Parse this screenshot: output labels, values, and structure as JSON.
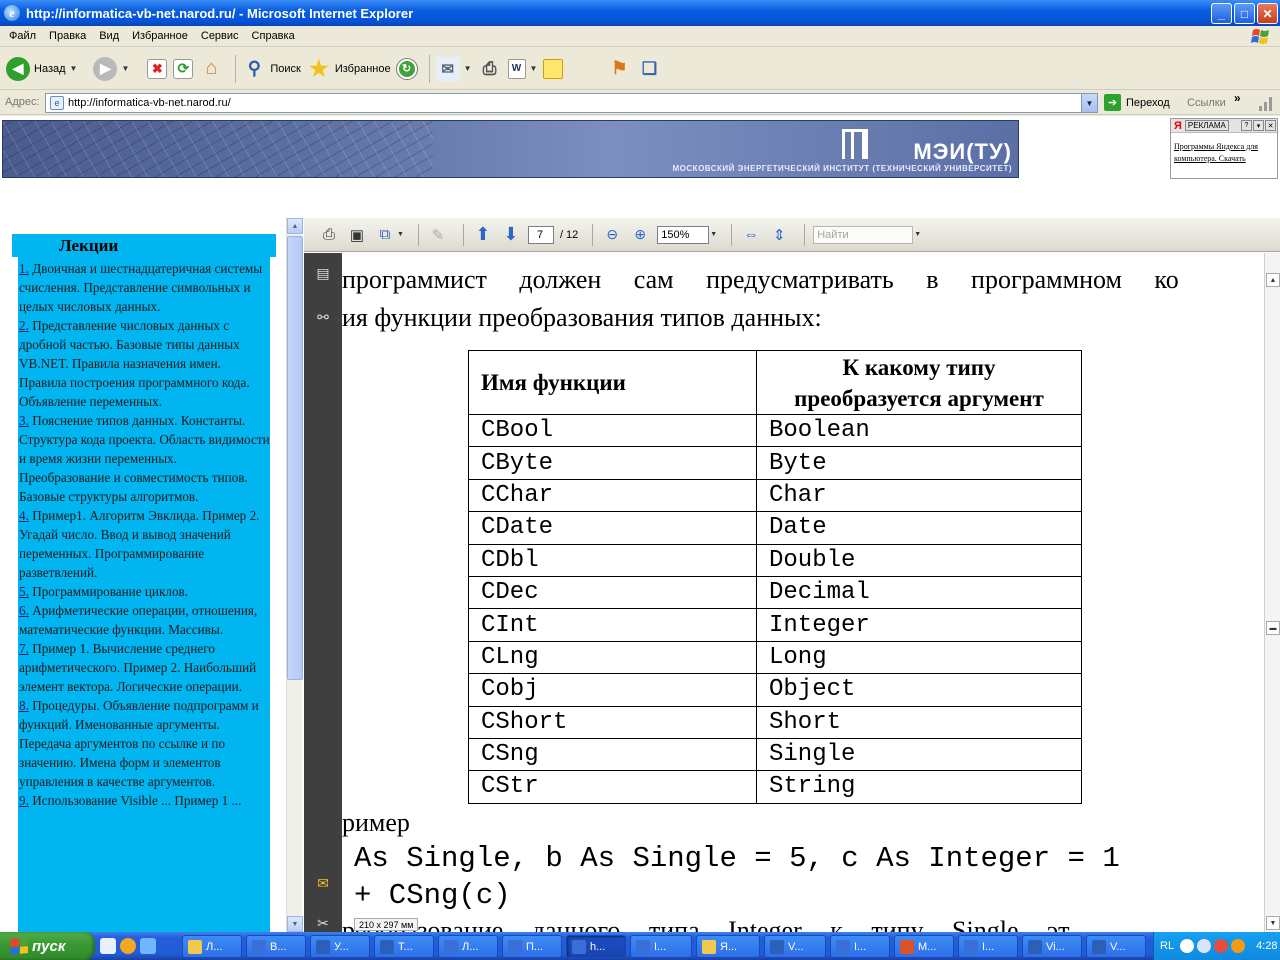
{
  "window": {
    "title": "http://informatica-vb-net.narod.ru/ - Microsoft Internet Explorer",
    "min": "_",
    "max": "□",
    "close": "✕"
  },
  "menu": [
    "Файл",
    "Правка",
    "Вид",
    "Избранное",
    "Сервис",
    "Справка"
  ],
  "toolbar": {
    "back": "Назад",
    "search": "Поиск",
    "favorites": "Избранное"
  },
  "address": {
    "label": "Адрес:",
    "url": "http://informatica-vb-net.narod.ru/",
    "go": "Переход",
    "links": "Ссылки",
    "chevron": "»"
  },
  "banner": {
    "title": "МЭИ(ТУ)",
    "subtitle": "МОСКОВСКИЙ ЭНЕРГЕТИЧЕСКИЙ ИНСТИТУТ (ТЕХНИЧЕСКИЙ УНИВЕРСИТЕТ)"
  },
  "ad": {
    "logo": "Я",
    "label": "РЕКЛАМА",
    "link": "Программы Яндекса для компьютера. Скачать"
  },
  "lectures": {
    "title": "Лекции",
    "items": [
      {
        "num": "1.",
        "text": " Двоичная и шестнадцатеричная системы счисления. Представление символьных и целых числовых данных."
      },
      {
        "num": "2.",
        "text": " Представление числовых данных с дробной частью. Базовые типы данных VB.NET. Правила назначения имен. Правила построения программного кода. Объявление переменных."
      },
      {
        "num": "3.",
        "text": " Пояснение типов данных. Константы. Структура кода проекта. Область видимости и время жизни переменных. Преобразование и совместимость типов. Базовые структуры алгоритмов."
      },
      {
        "num": "4.",
        "text": " Пример1. Алгоритм Эвклида. Пример 2. Угадай число. Ввод и вывод значений переменных. Программирование разветвлений."
      },
      {
        "num": "5.",
        "text": " Программирование циклов."
      },
      {
        "num": "6.",
        "text": " Арифметические операции, отношения, математические функции. Массивы."
      },
      {
        "num": "7.",
        "text": " Пример 1. Вычисление среднего арифметического. Пример 2. Наибольший элемент вектора. Логические операции."
      },
      {
        "num": "8.",
        "text": " Процедуры. Объявление подпрограмм и функций. Именованные аргументы. Передача аргументов по ссылке и по значению. Имена форм и элементов управления в качестве аргументов."
      },
      {
        "num": "9.",
        "text": " Использование Visible ... Пример 1 ..."
      }
    ]
  },
  "pdf": {
    "page": "7",
    "total": "/ 12",
    "zoom": "150%",
    "find_placeholder": "Найти",
    "paper": "210 x 297 мм",
    "line1": "программист должен сам предусматривать в программном ко",
    "line2": "ия функции преобразования типов данных:",
    "table_head": [
      "Имя функции",
      "К какому типу преобразуется аргумент"
    ],
    "table_rows": [
      [
        "CBool",
        "Boolean"
      ],
      [
        "CByte",
        "Byte"
      ],
      [
        "CChar",
        "Char"
      ],
      [
        "CDate",
        "Date"
      ],
      [
        "CDbl",
        "Double"
      ],
      [
        "CDec",
        "Decimal"
      ],
      [
        "CInt",
        "Integer"
      ],
      [
        "CLng",
        "Long"
      ],
      [
        "Cobj",
        "Object"
      ],
      [
        "CShort",
        "Short"
      ],
      [
        "CSng",
        "Single"
      ],
      [
        "CStr",
        "String"
      ]
    ],
    "line3": "ример",
    "code1": "As Single, b As Single = 5, c As Integer = 1",
    "code2": "+ CSng(c)",
    "line4": "реобразование данного типа Integer к типу Single эт"
  },
  "taskbar": {
    "start": "пуск",
    "tasks": [
      "Л...",
      "В...",
      "У...",
      "Т...",
      "Л...",
      "П...",
      "h...",
      "I...",
      "Я...",
      "V...",
      "I...",
      "М...",
      "I...",
      "Vi...",
      "V..."
    ],
    "lang": "RL",
    "time": "4:28"
  }
}
